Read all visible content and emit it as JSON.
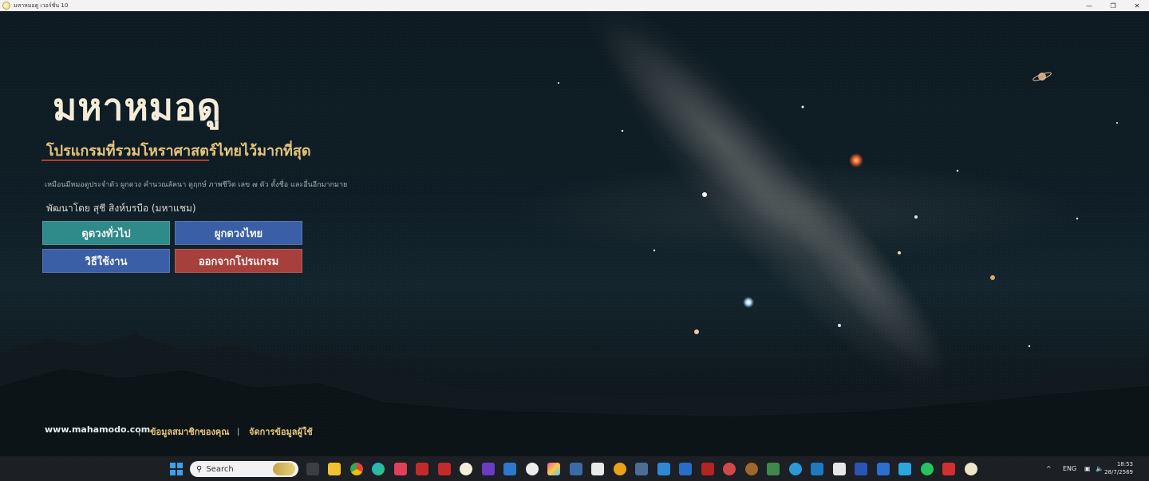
{
  "window": {
    "title": "มหาหมอดู เวอร์ชั่น 10",
    "controls": {
      "minimize": "—",
      "maximize": "❐",
      "close": "✕"
    }
  },
  "app": {
    "title": "มหาหมอดู",
    "subtitle": "โปรแกรมที่รวมโหราศาสตร์ไทยไว้มากที่สุด",
    "tagline": "เหมือนมีหมอดูประจำตัว ผูกดวง คำนวณลัคนา ดูฤกษ์ ภาพชีวิต เลข ๗ ตัว ตั้งชื่อ และอื่นอีกมากมาย",
    "developer": "พัฒนาโดย  สุชี สิงห์บรบือ (มหาแชม)",
    "buttons": {
      "general_horoscope": "ดูดวงทั่วไป",
      "thai_horoscope": "ผูกดวงไทย",
      "how_to_use": "วิธีใช้งาน",
      "exit": "ออกจากโปรแกรม"
    },
    "footer": {
      "website": "www.mahamodo.com",
      "separator": "|",
      "member_info": "ข้อมูลสมาชิกของคุณ",
      "manage_user": "จัดการข้อมูลผู้ใช้"
    },
    "colors": {
      "accent_gold": "#e6c57c",
      "button_teal": "#2f8a8a",
      "button_blue": "#3a5fa6",
      "button_red": "#a7403c"
    }
  },
  "taskbar": {
    "search_placeholder": "Search",
    "tray": {
      "chevron": "^",
      "language": "ENG"
    },
    "clock": {
      "time": "18:53",
      "date": "28/7/2569"
    }
  }
}
